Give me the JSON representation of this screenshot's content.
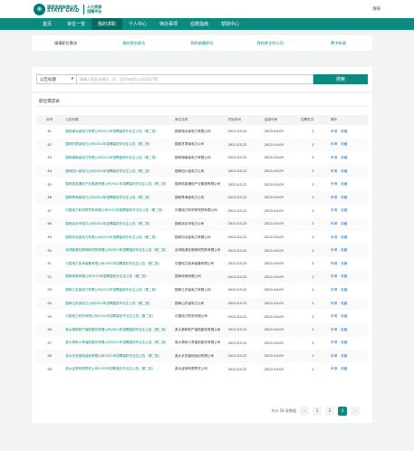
{
  "header": {
    "logo_cn": "国家电网有限公司",
    "logo_en": "STATE GRID",
    "logo_sub1": "人力资源",
    "logo_sub2": "招聘平台",
    "user": "洛阳"
  },
  "nav": [
    "首页",
    "单位一览",
    "我的求职",
    "个人中心",
    "待办事项",
    "应聘指南",
    "帮助中心"
  ],
  "tabs": [
    "填报职位需求",
    "我的报名职位",
    "我的收藏职位",
    "我的关注的公司",
    "聘书申请"
  ],
  "search": {
    "select_value": "公告标题",
    "placeholder": "请输入搜索关键词，如：北京市电力公司2017等",
    "button": "搜索"
  },
  "list": {
    "title": "职位需求表",
    "columns": [
      "序号",
      "公告标题",
      "单位名称",
      "开始时间",
      "结束时间",
      "招聘批次",
      "操作"
    ],
    "op_apply": "申请",
    "op_fav": "收藏",
    "rows": [
      {
        "no": "41",
        "title": "国网湖北省电力有限公司2022年招聘高校毕业生公告（第二批）",
        "unit": "国网湖北省电力有限公司",
        "start": "2022-03-22",
        "end": "2022-04-09",
        "batch": "2"
      },
      {
        "no": "42",
        "title": "国网甘肃省电力公司2022年招聘高校毕业生公告（第二批）",
        "unit": "国网甘肃省电力公司",
        "start": "2022-03-22",
        "end": "2022-04-09",
        "batch": "2"
      },
      {
        "no": "43",
        "title": "国网湖南省电力有限公司2022年招聘高校毕业生公告（第二批）",
        "unit": "国网湖南省电力有限公司",
        "start": "2022-03-22",
        "end": "2022-04-09",
        "batch": "2"
      },
      {
        "no": "44",
        "title": "国网四川省电力公司2022年招聘高校毕业生公告（第二批）",
        "unit": "国网四川省电力公司",
        "start": "2022-03-22",
        "end": "2022-04-09",
        "batch": "2"
      },
      {
        "no": "45",
        "title": "国网信息通信产业集团有限公司2022年招聘高校毕业生公告（第二批）",
        "unit": "国网信息通信产业集团有限公司",
        "start": "2022-03-22",
        "end": "2022-04-09",
        "batch": "2"
      },
      {
        "no": "46",
        "title": "国网青海省电力公司2022年招聘高校毕业生公告（第二批）",
        "unit": "国网青海省电力公司",
        "start": "2022-03-22",
        "end": "2022-04-09",
        "batch": "2"
      },
      {
        "no": "47",
        "title": "中国电力科学研究院有限公司2022年招聘高校毕业生公告（第二批）",
        "unit": "中国电力科学研究院有限公司",
        "start": "2022-03-22",
        "end": "2022-04-09",
        "batch": "2"
      },
      {
        "no": "48",
        "title": "国网北京市电力公司2022年招聘高校毕业生公告（第二批）",
        "unit": "国网北京市电力公司",
        "start": "2022-03-22",
        "end": "2022-04-09",
        "batch": "2"
      },
      {
        "no": "49",
        "title": "国网河北省电力有限公司2022年招聘高校毕业生公告（第二批）",
        "unit": "国网河北省电力有限公司",
        "start": "2022-03-22",
        "end": "2022-04-09",
        "batch": "2"
      },
      {
        "no": "50",
        "title": "全球能源互联网研究院有限公司2022年招聘高校毕业生公告（第二批）",
        "unit": "全球能源互联网研究院有限公司",
        "start": "2022-03-22",
        "end": "2022-04-09",
        "batch": "2"
      },
      {
        "no": "51",
        "title": "中国电力技术装备有限公司2022年招聘高校毕业生公告（第二批）",
        "unit": "中国电力技术装备有限公司",
        "start": "2022-03-22",
        "end": "2022-04-09",
        "batch": "2"
      },
      {
        "no": "52",
        "title": "国网电商有限公司2022年招聘高校毕业生公告（第二批）",
        "unit": "国网电商有限公司",
        "start": "2022-03-22",
        "end": "2022-04-09",
        "batch": "2"
      },
      {
        "no": "53",
        "title": "国网江苏省电力有限公司2022年招聘高校毕业生公告（第二批）",
        "unit": "国网江苏省电力有限公司",
        "start": "2022-03-22",
        "end": "2022-04-09",
        "batch": "2"
      },
      {
        "no": "54",
        "title": "国网山东省电力公司2022年招聘高校毕业生公告（第二批）",
        "unit": "国网山东省电力公司",
        "start": "2022-03-22",
        "end": "2022-04-09",
        "batch": "2"
      },
      {
        "no": "55",
        "title": "中国电力财务有限公司2022年招聘高校毕业生公告（第二批）",
        "unit": "中国电力财务有限公司",
        "start": "2022-03-22",
        "end": "2022-04-09",
        "batch": "2"
      },
      {
        "no": "56",
        "title": "英大泰和财产保险股份有限公司2022年招聘高校毕业生公告（第二批）",
        "unit": "英大泰和财产保险股份有限公司",
        "start": "2022-03-22",
        "end": "2022-04-09",
        "batch": "2"
      },
      {
        "no": "57",
        "title": "英大泰和人寿保险股份有限公司2022年招聘高校毕业生公告（第二批）",
        "unit": "英大泰和人寿保险股份有限公司",
        "start": "2022-03-22",
        "end": "2022-04-09",
        "batch": "2"
      },
      {
        "no": "58",
        "title": "英大长安保险经纪有限公司2022年招聘高校毕业生公告（第二批）",
        "unit": "英大长安保险经纪有限公司",
        "start": "2022-03-22",
        "end": "2022-04-09",
        "batch": "2"
      },
      {
        "no": "59",
        "title": "英大证券有限责任公司2022年招聘高校毕业生公告（第二批）",
        "unit": "英大证券有限责任公司",
        "start": "2022-03-22",
        "end": "2022-04-09",
        "batch": "2"
      }
    ]
  },
  "pagination": {
    "total_text": "共计 59 条数据",
    "prev": "‹",
    "pages": [
      "1",
      "2",
      "3"
    ],
    "current": "3",
    "next": "›"
  },
  "colors": {
    "brand": "#0c8a80",
    "nav_active": "#07695f",
    "link": "#1a73c7"
  }
}
